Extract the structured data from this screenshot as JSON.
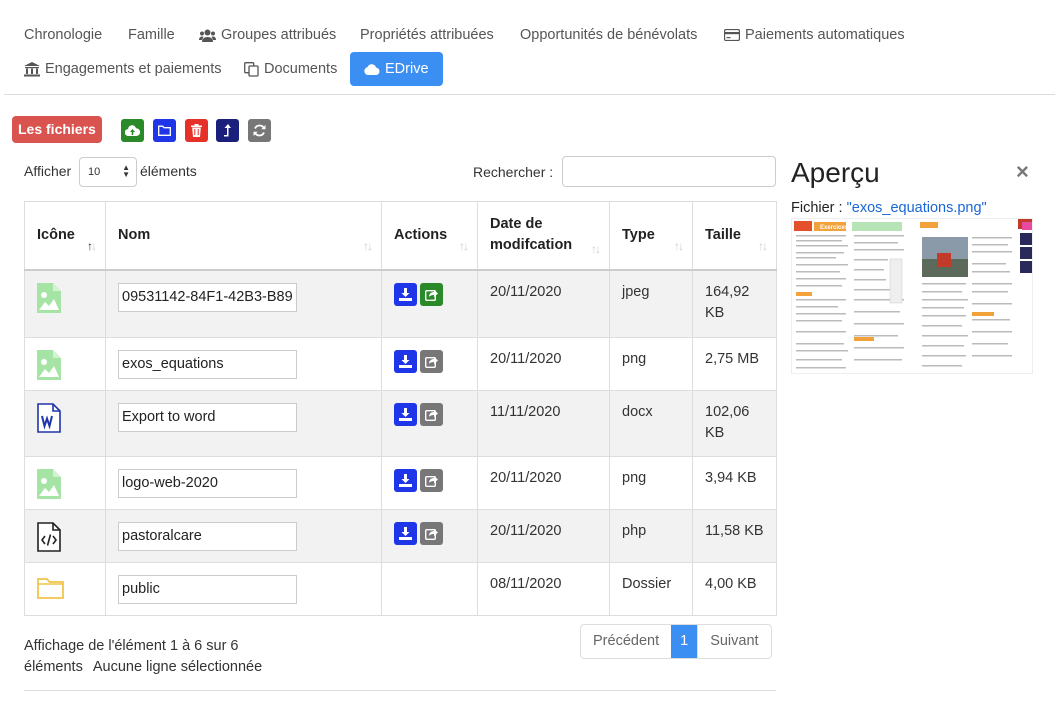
{
  "tabs": [
    {
      "label": "Chronologie",
      "icon": ""
    },
    {
      "label": "Famille",
      "icon": ""
    },
    {
      "label": "Groupes attribués",
      "icon": "users-icon"
    },
    {
      "label": "Propriétés attribuées",
      "icon": ""
    },
    {
      "label": "Opportunités de bénévolats",
      "icon": ""
    },
    {
      "label": "Paiements automatiques",
      "icon": "credit-card-icon"
    },
    {
      "label": "Engagements et paiements",
      "icon": "bank-icon"
    },
    {
      "label": "Documents",
      "icon": "copy-icon"
    },
    {
      "label": "EDrive",
      "icon": "cloud-icon",
      "active": true
    }
  ],
  "toolbar": {
    "files_label": "Les fichiers",
    "buttons": [
      "upload-icon",
      "folder-icon",
      "trash-icon",
      "level-up-icon",
      "refresh-icon"
    ]
  },
  "table_controls": {
    "show_label": "Afficher",
    "page_length": "10",
    "items_label": "éléments",
    "search_label": "Rechercher :",
    "search_value": ""
  },
  "columns": [
    "Icône",
    "Nom",
    "Actions",
    "Date de modifcation",
    "Type",
    "Taille"
  ],
  "rows": [
    {
      "icon": "image-file-icon",
      "name": "09531142-84F1-42B3-B89",
      "actions": [
        "download",
        "share"
      ],
      "date": "20/11/2020",
      "type": "jpeg",
      "size": "164,92 KB"
    },
    {
      "icon": "image-file-icon",
      "name": "exos_equations",
      "actions": [
        "download",
        "share-disabled"
      ],
      "date": "20/11/2020",
      "type": "png",
      "size": "2,75 MB"
    },
    {
      "icon": "word-file-icon",
      "name": "Export to word",
      "actions": [
        "download",
        "share-disabled"
      ],
      "date": "11/11/2020",
      "type": "docx",
      "size": "102,06 KB"
    },
    {
      "icon": "image-file-icon",
      "name": "logo-web-2020",
      "actions": [
        "download",
        "share-disabled"
      ],
      "date": "20/11/2020",
      "type": "png",
      "size": "3,94 KB"
    },
    {
      "icon": "code-file-icon",
      "name": "pastoralcare",
      "actions": [
        "download",
        "share-disabled"
      ],
      "date": "20/11/2020",
      "type": "php",
      "size": "11,58 KB"
    },
    {
      "icon": "folder-icon",
      "name": "public",
      "actions": [],
      "date": "08/11/2020",
      "type": "Dossier",
      "size": "4,00 KB"
    }
  ],
  "footer": {
    "info": "Affichage de l'élément 1 à 6 sur 6 éléments",
    "selection": "Aucune ligne sélectionnée",
    "prev_label": "Précédent",
    "current_page": "1",
    "next_label": "Suivant"
  },
  "preview": {
    "title": "Aperçu",
    "close_symbol": "×",
    "file_prefix": "Fichier :",
    "file_name": "\"exos_equations.png\"",
    "thumb_heading": "Exercices"
  },
  "colors": {
    "accent": "#3b8ff3",
    "files_button": "#d9534f",
    "action_blue": "#1f35e8",
    "action_green": "#2a8a2a",
    "action_grey": "#777777"
  }
}
